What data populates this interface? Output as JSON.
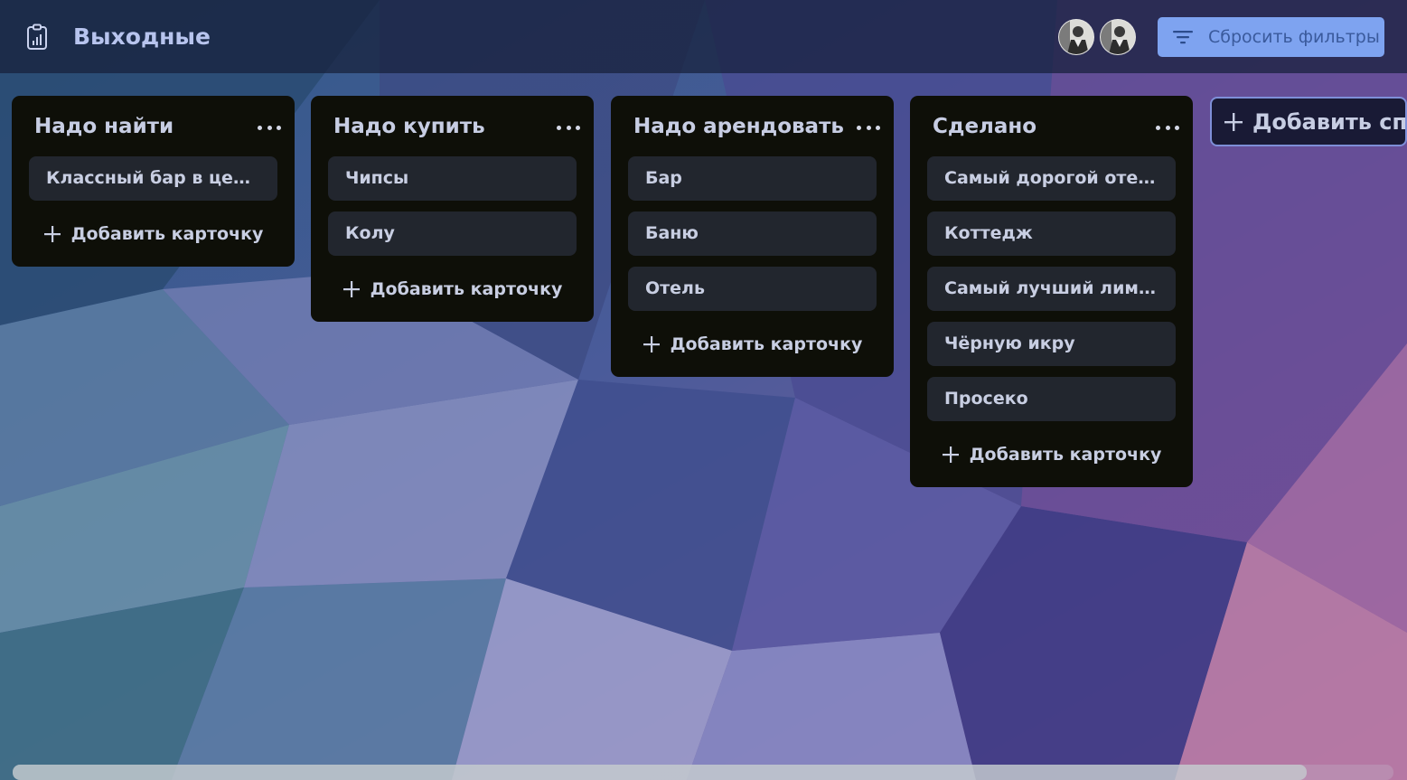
{
  "board": {
    "title": "Выходные"
  },
  "toolbar": {
    "reset_filters_label": "Сбросить фильтры"
  },
  "lists": [
    {
      "title": "Надо найти",
      "cards": [
        "Классный бар в центре"
      ],
      "add_card_label": "Добавить карточку"
    },
    {
      "title": "Надо купить",
      "cards": [
        "Чипсы",
        "Колу"
      ],
      "add_card_label": "Добавить карточку"
    },
    {
      "title": "Надо арендовать",
      "cards": [
        "Бар",
        "Баню",
        "Отель"
      ],
      "add_card_label": "Добавить карточку"
    },
    {
      "title": "Сделано",
      "cards": [
        "Самый дорогой отель",
        "Коттедж",
        "Самый лучший лимузин",
        "Чёрную икру",
        "Просеко"
      ],
      "add_card_label": "Добавить карточку"
    }
  ],
  "add_list_label": "Добавить список",
  "colors": {
    "list_bg": "#0e0f08",
    "card_bg": "#22262e",
    "accent_button": "#7ea3f0",
    "title_text": "#b7c4ee"
  },
  "icons": {
    "board": "clipboard-chart-icon",
    "filter": "filter-lines-icon",
    "list_menu": "more-dots-icon",
    "add": "plus-icon"
  }
}
